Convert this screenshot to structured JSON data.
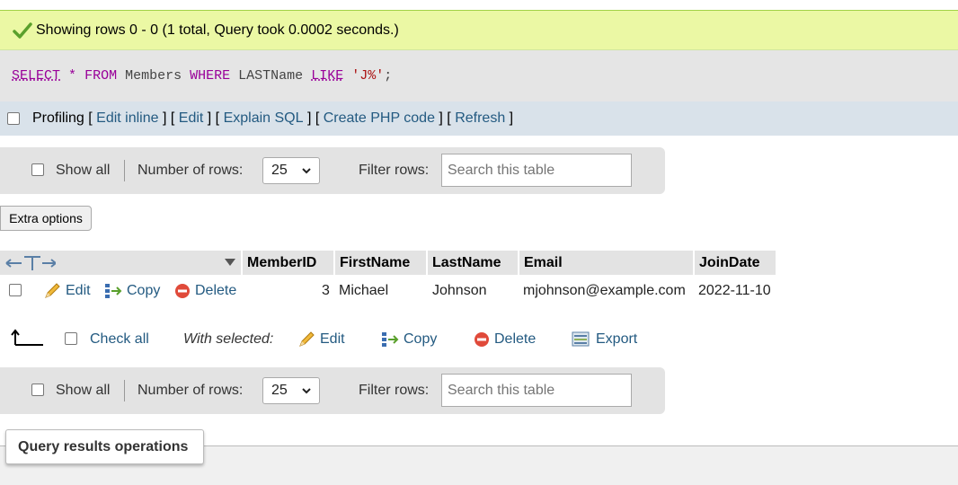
{
  "status": {
    "message": "Showing rows 0 - 0 (1 total, Query took 0.0002 seconds.)",
    "icon": "checkmark-icon"
  },
  "sql": {
    "select": "SELECT",
    "star": "*",
    "from": "FROM",
    "table": "Members",
    "where": "WHERE",
    "column": "LASTName",
    "like": "LIKE",
    "pattern": "'J%'",
    "semicolon": ";"
  },
  "profiling": {
    "label": "Profiling",
    "open": "[ ",
    "sep": " ] [ ",
    "close": " ]",
    "links": [
      "Edit inline",
      "Edit",
      "Explain SQL",
      "Create PHP code",
      "Refresh"
    ]
  },
  "nav": {
    "show_all": "Show all",
    "num_rows_label": "Number of rows:",
    "num_rows_value": "25",
    "filter_label": "Filter rows:",
    "filter_placeholder": "Search this table"
  },
  "extra_options": "Extra options",
  "table": {
    "columns": [
      "MemberID",
      "FirstName",
      "LastName",
      "Email",
      "JoinDate"
    ],
    "rows": [
      {
        "actions": {
          "edit": "Edit",
          "copy": "Copy",
          "delete": "Delete"
        },
        "MemberID": "3",
        "FirstName": "Michael",
        "LastName": "Johnson",
        "Email": "mjohnson@example.com",
        "JoinDate": "2022-11-10"
      }
    ]
  },
  "with_selected": {
    "check_all": "Check all",
    "label": "With selected:",
    "edit": "Edit",
    "copy": "Copy",
    "delete": "Delete",
    "export": "Export"
  },
  "query_results_operations": "Query results operations",
  "colors": {
    "success_bg": "#ebf8a4",
    "link": "#235a81",
    "keyword": "#990099",
    "string": "#aa1111",
    "header_bg": "#e3e3e3"
  }
}
